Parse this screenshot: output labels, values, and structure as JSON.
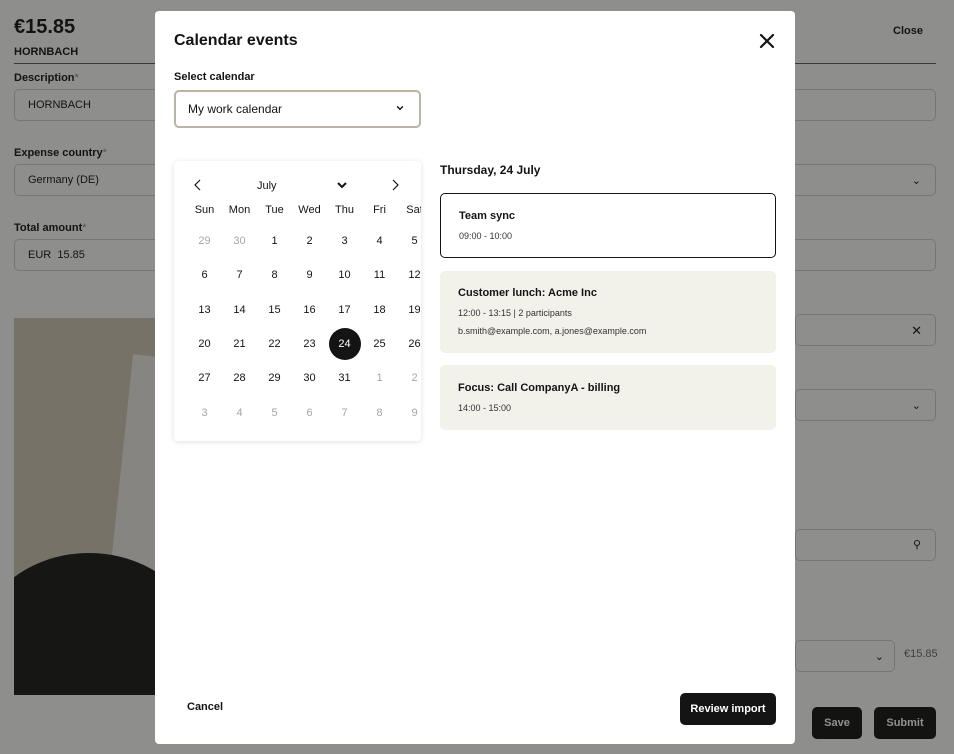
{
  "background": {
    "amount": "€15.85",
    "merchant": "HORNBACH",
    "close_label": "Close",
    "description_label": "Description",
    "description_value": "HORNBACH",
    "country_label": "Expense country",
    "country_value": "Germany (DE)",
    "total_label": "Total amount",
    "currency": "EUR",
    "total_value": "15.85",
    "required_mark": "*",
    "mini_amount": "€15.85",
    "save_label": "Save",
    "submit_label": "Submit"
  },
  "modal": {
    "title": "Calendar events",
    "select_label": "Select calendar",
    "selected_calendar": "My work calendar",
    "cancel_label": "Cancel",
    "review_label": "Review import"
  },
  "calendar": {
    "month": "July",
    "weekdays": [
      "Sun",
      "Mon",
      "Tue",
      "Wed",
      "Thu",
      "Fri",
      "Sat"
    ],
    "weeks": [
      [
        {
          "d": "29",
          "m": 1
        },
        {
          "d": "30",
          "m": 1
        },
        {
          "d": "1"
        },
        {
          "d": "2"
        },
        {
          "d": "3"
        },
        {
          "d": "4"
        },
        {
          "d": "5"
        }
      ],
      [
        {
          "d": "6"
        },
        {
          "d": "7"
        },
        {
          "d": "8"
        },
        {
          "d": "9"
        },
        {
          "d": "10"
        },
        {
          "d": "11"
        },
        {
          "d": "12"
        }
      ],
      [
        {
          "d": "13"
        },
        {
          "d": "14"
        },
        {
          "d": "15"
        },
        {
          "d": "16"
        },
        {
          "d": "17"
        },
        {
          "d": "18"
        },
        {
          "d": "19"
        }
      ],
      [
        {
          "d": "20"
        },
        {
          "d": "21"
        },
        {
          "d": "22"
        },
        {
          "d": "23"
        },
        {
          "d": "24",
          "s": 1
        },
        {
          "d": "25"
        },
        {
          "d": "26"
        }
      ],
      [
        {
          "d": "27"
        },
        {
          "d": "28"
        },
        {
          "d": "29"
        },
        {
          "d": "30"
        },
        {
          "d": "31"
        },
        {
          "d": "1",
          "m": 1
        },
        {
          "d": "2",
          "m": 1
        }
      ],
      [
        {
          "d": "3",
          "m": 1
        },
        {
          "d": "4",
          "m": 1
        },
        {
          "d": "5",
          "m": 1
        },
        {
          "d": "6",
          "m": 1
        },
        {
          "d": "7",
          "m": 1
        },
        {
          "d": "8",
          "m": 1
        },
        {
          "d": "9",
          "m": 1
        }
      ]
    ]
  },
  "events": {
    "date_heading": "Thursday, 24 July",
    "items": [
      {
        "title": "Team sync",
        "time": "09:00 - 10:00"
      },
      {
        "title": "Customer lunch: Acme Inc",
        "time": "12:00 - 13:15 | 2 participants",
        "attendees": "b.smith@example.com, a.jones@example.com"
      },
      {
        "title": "Focus: Call CompanyA - billing",
        "time": "14:00 - 15:00"
      }
    ]
  }
}
